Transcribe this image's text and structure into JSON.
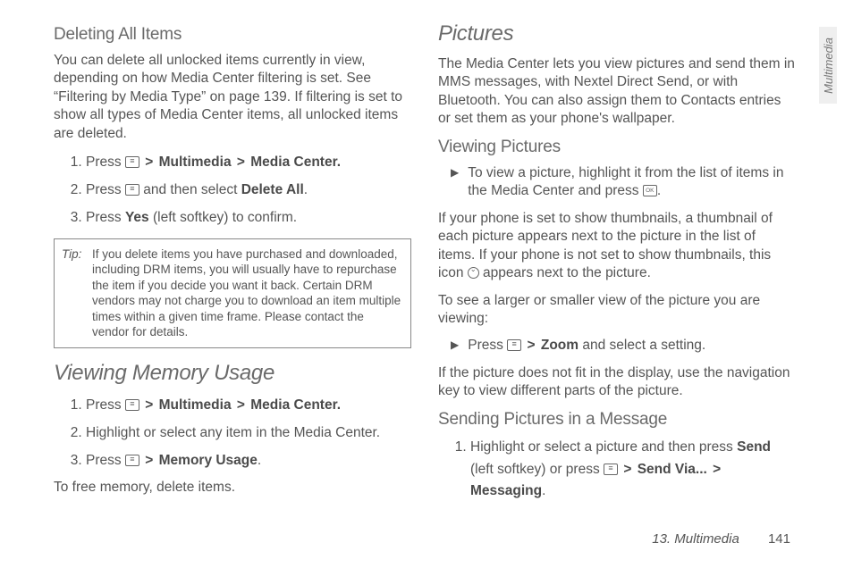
{
  "side_tab": "Multimedia",
  "footer": {
    "chapter": "13. Multimedia",
    "page": "141"
  },
  "left": {
    "h1": "Deleting All Items",
    "p1": "You can delete all unlocked items currently in view, depending on how Media Center filtering is set. See “Filtering by Media Type” on page 139. If filtering is set to show all types of Media Center items, all unlocked items are deleted.",
    "step1_a": "Press ",
    "step1_b": "Multimedia",
    "step1_c": "Media Center.",
    "step2_a": "Press ",
    "step2_b": " and then select ",
    "step2_c": "Delete All",
    "step2_d": ".",
    "step3_a": "Press ",
    "step3_b": "Yes",
    "step3_c": " (left softkey) to confirm.",
    "tip_label": "Tip:",
    "tip_body": "If you delete items you have purchased and downloaded, including DRM items, you will usually have to repurchase the item if you decide you want it back. Certain DRM vendors may not charge you to download an item multiple times within a given time frame. Please contact the vendor for details.",
    "h2": "Viewing Memory Usage",
    "m_step1_a": "Press ",
    "m_step1_b": "Multimedia",
    "m_step1_c": "Media Center.",
    "m_step2": "Highlight or select any item in the Media Center.",
    "m_step3_a": "Press ",
    "m_step3_b": "Memory Usage",
    "m_step3_c": ".",
    "p2": "To free memory, delete items."
  },
  "right": {
    "h1": "Pictures",
    "p1": "The Media Center lets you view pictures and send them in MMS messages, with Nextel Direct Send, or with Bluetooth. You can also assign them to Contacts entries or set them as your phone's wallpaper.",
    "h2": "Viewing Pictures",
    "b1_a": "To view a picture, highlight it from the list of items in the Media Center and press ",
    "b1_b": ".",
    "p2_a": "If your phone is set to show thumbnails, a thumbnail of each picture appears next to the picture in the list of items. If your phone is not set to show thumbnails, this icon ",
    "p2_b": " appears next to the picture.",
    "p3": "To see a larger or smaller view of the picture you are viewing:",
    "b2_a": "Press ",
    "b2_b": "Zoom",
    "b2_c": " and select a setting.",
    "p4": "If the picture does not fit in the display, use the navigation key to view different parts of the picture.",
    "h3": "Sending Pictures in a Message",
    "s1_a": "Highlight or select a picture and then press ",
    "s1_b": "Send",
    "s1_c": " (left softkey) or press ",
    "s1_d": "Send Via...",
    "s1_e": "Messaging",
    "s1_f": "."
  },
  "gt": ">"
}
